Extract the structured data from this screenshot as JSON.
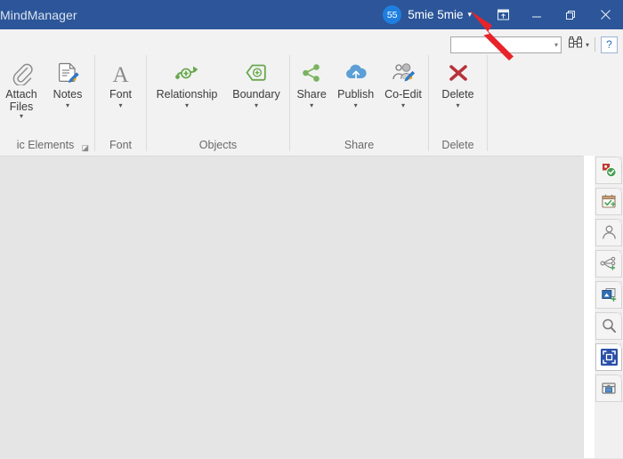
{
  "titlebar": {
    "app_title": "MindManager",
    "avatar_badge": "55",
    "account_name": "5mie 5mie",
    "account_caret": "▾",
    "ribbon_display_icon": "ribbon-display-options-icon",
    "minimize_label": "Minimize",
    "restore_label": "Restore Down",
    "close_label": "Close",
    "bg_color": "#2c5699",
    "avatar_color": "#1f7fe0"
  },
  "quick_access": {
    "search_value": "",
    "search_placeholder": "",
    "search_caret": "▾",
    "find_icon": "binoculars-find-icon",
    "find_caret": "▾",
    "help_label": "?",
    "help_color": "#2a6fc4"
  },
  "ribbon": {
    "groups": [
      {
        "label": "ic Elements",
        "has_launcher": true,
        "launcher_glyph": "◪",
        "buttons": [
          {
            "label": "Attach\nFiles",
            "caret": "▾",
            "icon": "paperclip-icon"
          },
          {
            "label": "Notes",
            "caret": "▾",
            "icon": "notes-page-pencil-icon"
          }
        ]
      },
      {
        "label": "Font",
        "has_launcher": false,
        "buttons": [
          {
            "label": "Font",
            "caret": "▾",
            "icon": "font-letter-a-icon"
          }
        ]
      },
      {
        "label": "Objects",
        "has_launcher": false,
        "buttons": [
          {
            "label": "Relationship",
            "caret": "▾",
            "icon": "relationship-arrow-icon"
          },
          {
            "label": "Boundary",
            "caret": "▾",
            "icon": "boundary-shape-icon"
          }
        ]
      },
      {
        "label": "Share",
        "has_launcher": false,
        "buttons": [
          {
            "label": "Share",
            "caret": "▾",
            "icon": "share-nodes-icon"
          },
          {
            "label": "Publish",
            "caret": "▾",
            "icon": "cloud-upload-icon"
          },
          {
            "label": "Co-Edit",
            "caret": "▾",
            "icon": "co-edit-person-pencil-icon"
          }
        ]
      },
      {
        "label": "Delete",
        "has_launcher": false,
        "buttons": [
          {
            "label": "Delete",
            "caret": "▾",
            "icon": "red-x-delete-icon"
          }
        ]
      }
    ]
  },
  "canvas": {
    "background_color": "#e5e5e5",
    "content": ""
  },
  "task_rail": {
    "buttons": [
      {
        "icon": "task-info-flag-check-icon",
        "selected": false
      },
      {
        "icon": "calendar-add-task-icon",
        "selected": false
      },
      {
        "icon": "resources-person-icon",
        "selected": false
      },
      {
        "icon": "add-topic-map-icon",
        "selected": false
      },
      {
        "icon": "add-image-icon",
        "selected": false
      },
      {
        "icon": "search-magnifier-icon",
        "selected": false
      },
      {
        "icon": "selection-frame-icon",
        "selected": true
      },
      {
        "icon": "library-folder-icon",
        "selected": false
      }
    ]
  },
  "annotation": {
    "arrow_color": "#e8232a",
    "points_at": "account-name-dropdown"
  }
}
